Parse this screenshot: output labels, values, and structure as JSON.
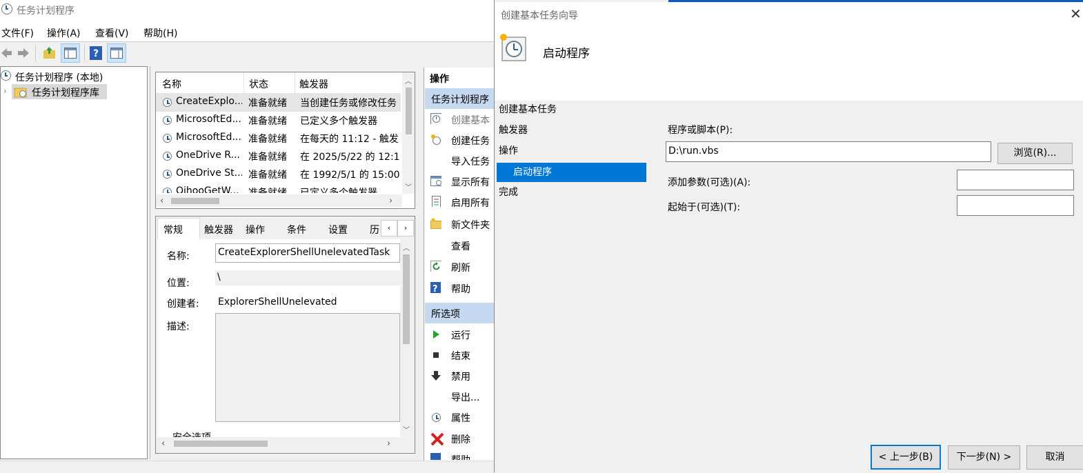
{
  "main_window": {
    "title": "任务计划程序",
    "menu": [
      "文件(F)",
      "操作(A)",
      "查看(V)",
      "帮助(H)"
    ]
  },
  "tree": {
    "root": "任务计划程序 (本地)",
    "library": "任务计划程序库"
  },
  "task_list": {
    "columns": [
      "名称",
      "状态",
      "触发器"
    ],
    "rows": [
      {
        "name": "CreateExplo...",
        "status": "准备就绪",
        "trigger": "当创建任务或修改任务"
      },
      {
        "name": "MicrosoftEd...",
        "status": "准备就绪",
        "trigger": "已定义多个触发器"
      },
      {
        "name": "MicrosoftEd...",
        "status": "准备就绪",
        "trigger": "在每天的 11:12 - 触发"
      },
      {
        "name": "OneDrive R...",
        "status": "准备就绪",
        "trigger": "在 2025/5/22 的 12:1"
      },
      {
        "name": "OneDrive St...",
        "status": "准备就绪",
        "trigger": "在 1992/5/1 的 15:00"
      },
      {
        "name": "QihooGetW...",
        "status": "准备就绪",
        "trigger": "已定义多个触发器"
      }
    ]
  },
  "detail": {
    "tabs": [
      "常规",
      "触发器",
      "操作",
      "条件",
      "设置",
      "历"
    ],
    "name_label": "名称:",
    "name_value": "CreateExplorerShellUnelevatedTask",
    "location_label": "位置:",
    "location_value": "\\",
    "author_label": "创建者:",
    "author_value": "ExplorerShellUnelevated",
    "desc_label": "描述:",
    "security_label": "安全选项"
  },
  "actions": {
    "header": "操作",
    "section1": "任务计划程序",
    "items1": [
      "创建基本",
      "创建任务",
      "导入任务",
      "显示所有",
      "启用所有",
      "新文件夹",
      "查看",
      "刷新",
      "帮助"
    ],
    "section2": "所选项",
    "items2": [
      "运行",
      "结束",
      "禁用",
      "导出...",
      "属性",
      "删除",
      "帮助"
    ]
  },
  "wizard": {
    "title": "创建基本任务向导",
    "heading": "启动程序",
    "steps": [
      "创建基本任务",
      "触发器",
      "操作",
      "启动程序",
      "完成"
    ],
    "program_label": "程序或脚本(P):",
    "program_value": "D:\\run.vbs",
    "browse_btn": "浏览(R)...",
    "args_label": "添加参数(可选)(A):",
    "start_label": "起始于(可选)(T):",
    "back_btn": "< 上一步(B)",
    "next_btn": "下一步(N) >",
    "cancel_btn": "取消"
  }
}
